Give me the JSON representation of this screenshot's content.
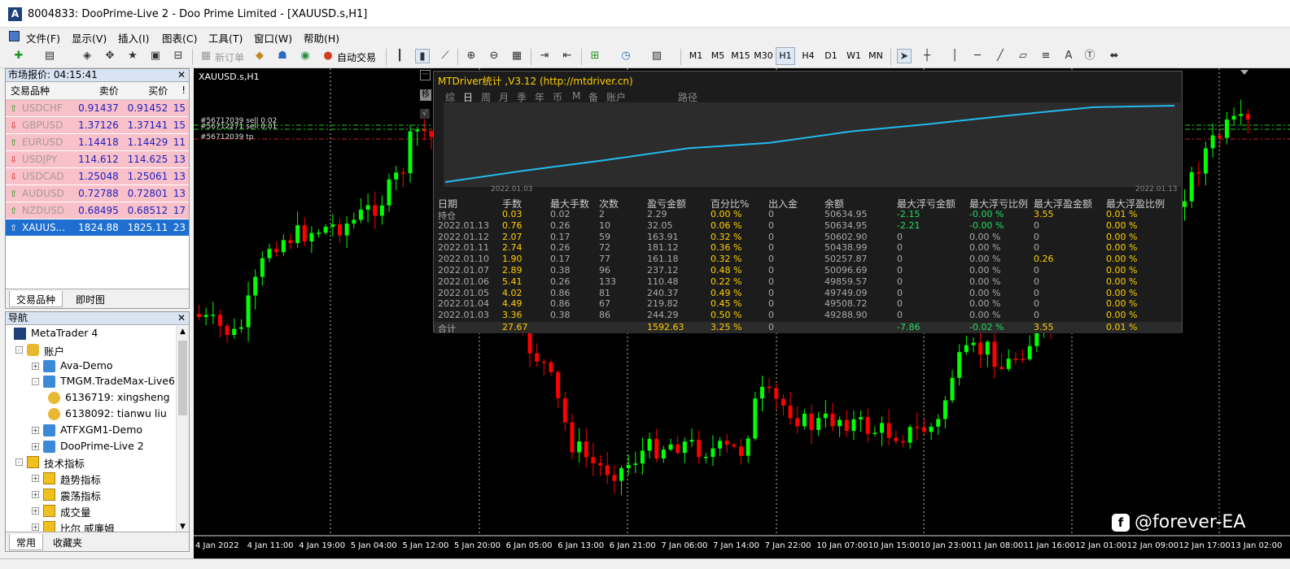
{
  "window": {
    "title": "8004833: DooPrime-Live 2 - Doo Prime Limited - [XAUUSD.s,H1]"
  },
  "menu": [
    "文件(F)",
    "显示(V)",
    "插入(I)",
    "图表(C)",
    "工具(T)",
    "窗口(W)",
    "帮助(H)"
  ],
  "toolbar": {
    "new_order": "新订单",
    "auto_trade": "自动交易",
    "timeframes": [
      "M1",
      "M5",
      "M15",
      "M30",
      "H1",
      "H4",
      "D1",
      "W1",
      "MN"
    ],
    "selected_timeframe": "H1"
  },
  "market_watch": {
    "title": "市场报价: 04:15:41",
    "columns": [
      "交易品种",
      "卖价",
      "买价",
      "!"
    ],
    "rows": [
      {
        "symbol": "USDCHF",
        "bid": "0.91437",
        "ask": "0.91452",
        "spread": "15",
        "dir": "up"
      },
      {
        "symbol": "GBPUSD",
        "bid": "1.37126",
        "ask": "1.37141",
        "spread": "15",
        "dir": "down"
      },
      {
        "symbol": "EURUSD",
        "bid": "1.14418",
        "ask": "1.14429",
        "spread": "11",
        "dir": "up"
      },
      {
        "symbol": "USDJPY",
        "bid": "114.612",
        "ask": "114.625",
        "spread": "13",
        "dir": "down"
      },
      {
        "symbol": "USDCAD",
        "bid": "1.25048",
        "ask": "1.25061",
        "spread": "13",
        "dir": "down"
      },
      {
        "symbol": "AUDUSD",
        "bid": "0.72788",
        "ask": "0.72801",
        "spread": "13",
        "dir": "up"
      },
      {
        "symbol": "NZDUSD",
        "bid": "0.68495",
        "ask": "0.68512",
        "spread": "17",
        "dir": "up"
      },
      {
        "symbol": "XAUUS...",
        "bid": "1824.88",
        "ask": "1825.11",
        "spread": "23",
        "dir": "up"
      }
    ],
    "tabs": [
      "交易品种",
      "即时图"
    ]
  },
  "navigator": {
    "title": "导航",
    "items": [
      {
        "label": "MetaTrader 4"
      },
      {
        "label": "账户"
      },
      {
        "label": "Ava-Demo"
      },
      {
        "label": "TMGM.TradeMax-Live6"
      },
      {
        "label": "6136719: xingsheng"
      },
      {
        "label": "6138092: tianwu liu"
      },
      {
        "label": "ATFXGM1-Demo"
      },
      {
        "label": "DooPrime-Live 2"
      },
      {
        "label": "技术指标"
      },
      {
        "label": "趋势指标"
      },
      {
        "label": "震荡指标"
      },
      {
        "label": "成交量"
      },
      {
        "label": "比尔 威廉姆"
      }
    ],
    "tabs": [
      "常用",
      "收藏夹"
    ]
  },
  "chart": {
    "label": "XAUUSD.s,H1",
    "order_labels": [
      "#56717039 sell 0.02",
      "#56712271 sell 0.01",
      "#56712039 tp"
    ],
    "x_labels": [
      "4 Jan 2022",
      "4 Jan 11:00",
      "4 Jan 19:00",
      "5 Jan 04:00",
      "5 Jan 12:00",
      "5 Jan 20:00",
      "6 Jan 05:00",
      "6 Jan 13:00",
      "6 Jan 21:00",
      "7 Jan 06:00",
      "7 Jan 14:00",
      "7 Jan 22:00",
      "10 Jan 07:00",
      "10 Jan 15:00",
      "10 Jan 23:00",
      "11 Jan 08:00",
      "11 Jan 16:00",
      "12 Jan 01:00",
      "12 Jan 09:00",
      "12 Jan 17:00",
      "13 Jan 02:00"
    ],
    "watermark": "@forever-EA",
    "bull_color": "#00ff00",
    "bear_color": "#ff0000"
  },
  "mtdriver": {
    "title": "MTDriver统计 ,V3.12 (http://mtdriver.cn)",
    "tabs": [
      "综",
      "日",
      "周",
      "月",
      "季",
      "年",
      "币",
      "M",
      "备",
      "账户",
      "路径"
    ],
    "active_tab": "日",
    "equity_start_label": "2022.01.03",
    "equity_end_label": "2022.01.13",
    "columns": [
      "日期",
      "手数",
      "最大手数",
      "次数",
      "盈亏金额",
      "百分比%",
      "出入金",
      "余额",
      "最大浮亏金额",
      "最大浮亏比例",
      "最大浮盈金额",
      "最大浮盈比例"
    ],
    "rows": [
      [
        "持仓",
        "0.03",
        "0.02",
        "2",
        "2.29",
        "0.00 %",
        "0",
        "50634.95",
        "-2.15",
        "-0.00 %",
        "3.55",
        "0.01 %"
      ],
      [
        "2022.01.13",
        "0.76",
        "0.26",
        "10",
        "32.05",
        "0.06 %",
        "0",
        "50634.95",
        "-2.21",
        "-0.00 %",
        "0",
        "0.00 %"
      ],
      [
        "2022.01.12",
        "2.07",
        "0.17",
        "59",
        "163.91",
        "0.32 %",
        "0",
        "50602.90",
        "0",
        "0.00 %",
        "0",
        "0.00 %"
      ],
      [
        "2022.01.11",
        "2.74",
        "0.26",
        "72",
        "181.12",
        "0.36 %",
        "0",
        "50438.99",
        "0",
        "0.00 %",
        "0",
        "0.00 %"
      ],
      [
        "2022.01.10",
        "1.90",
        "0.17",
        "77",
        "161.18",
        "0.32 %",
        "0",
        "50257.87",
        "0",
        "0.00 %",
        "0.26",
        "0.00 %"
      ],
      [
        "2022.01.07",
        "2.89",
        "0.38",
        "96",
        "237.12",
        "0.48 %",
        "0",
        "50096.69",
        "0",
        "0.00 %",
        "0",
        "0.00 %"
      ],
      [
        "2022.01.06",
        "5.41",
        "0.26",
        "133",
        "110.48",
        "0.22 %",
        "0",
        "49859.57",
        "0",
        "0.00 %",
        "0",
        "0.00 %"
      ],
      [
        "2022.01.05",
        "4.02",
        "0.86",
        "81",
        "240.37",
        "0.49 %",
        "0",
        "49749.09",
        "0",
        "0.00 %",
        "0",
        "0.00 %"
      ],
      [
        "2022.01.04",
        "4.49",
        "0.86",
        "67",
        "219.82",
        "0.45 %",
        "0",
        "49508.72",
        "0",
        "0.00 %",
        "0",
        "0.00 %"
      ],
      [
        "2022.01.03",
        "3.36",
        "0.38",
        "86",
        "244.29",
        "0.50 %",
        "0",
        "49288.90",
        "0",
        "0.00 %",
        "0",
        "0.00 %"
      ]
    ],
    "total": [
      "合计",
      "27.67",
      "",
      "",
      "1592.63",
      "3.25 %",
      "0",
      "",
      "-7.86",
      "-0.02 %",
      "3.55",
      "0.01 %"
    ]
  }
}
